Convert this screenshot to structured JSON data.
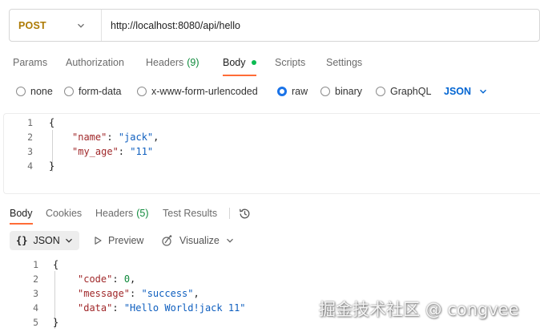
{
  "request": {
    "method": "POST",
    "url": "http://localhost:8080/api/hello"
  },
  "request_tabs": [
    {
      "label": "Params"
    },
    {
      "label": "Authorization"
    },
    {
      "label": "Headers",
      "count": "(9)"
    },
    {
      "label": "Body"
    },
    {
      "label": "Scripts"
    },
    {
      "label": "Settings"
    }
  ],
  "body_types": {
    "options": [
      "none",
      "form-data",
      "x-www-form-urlencoded",
      "raw",
      "binary",
      "GraphQL"
    ],
    "selected": "raw",
    "format": "JSON"
  },
  "request_body": {
    "line_numbers": [
      "1",
      "2",
      "3",
      "4"
    ],
    "lines": [
      {
        "open": "{"
      },
      {
        "key": "\"name\"",
        "colon": ": ",
        "value": "\"jack\"",
        "comma": ","
      },
      {
        "key": "\"my_age\"",
        "colon": ": ",
        "value": "\"11\""
      },
      {
        "close": "}"
      }
    ]
  },
  "response_tabs": [
    {
      "label": "Body"
    },
    {
      "label": "Cookies"
    },
    {
      "label": "Headers",
      "count": "(5)"
    },
    {
      "label": "Test Results"
    }
  ],
  "response_toolbar": {
    "format": "JSON",
    "braces": "{}",
    "preview": "Preview",
    "visualize": "Visualize"
  },
  "response_body": {
    "line_numbers": [
      "1",
      "2",
      "3",
      "4",
      "5"
    ],
    "lines": [
      {
        "open": "{"
      },
      {
        "key": "\"code\"",
        "colon": ": ",
        "value": "0",
        "comma": ","
      },
      {
        "key": "\"message\"",
        "colon": ": ",
        "value": "\"success\"",
        "comma": ","
      },
      {
        "key": "\"data\"",
        "colon": ": ",
        "value": "\"Hello World!jack 11\""
      },
      {
        "close": "}"
      }
    ]
  },
  "watermark": "掘金技术社区 @ congvee",
  "colors": {
    "method": "#ad7a03",
    "accent": "#ff6c37",
    "json_format": "#0265d2",
    "count": "#0f8a3c",
    "key": "#a0282a",
    "string": "#0f5fbf"
  }
}
